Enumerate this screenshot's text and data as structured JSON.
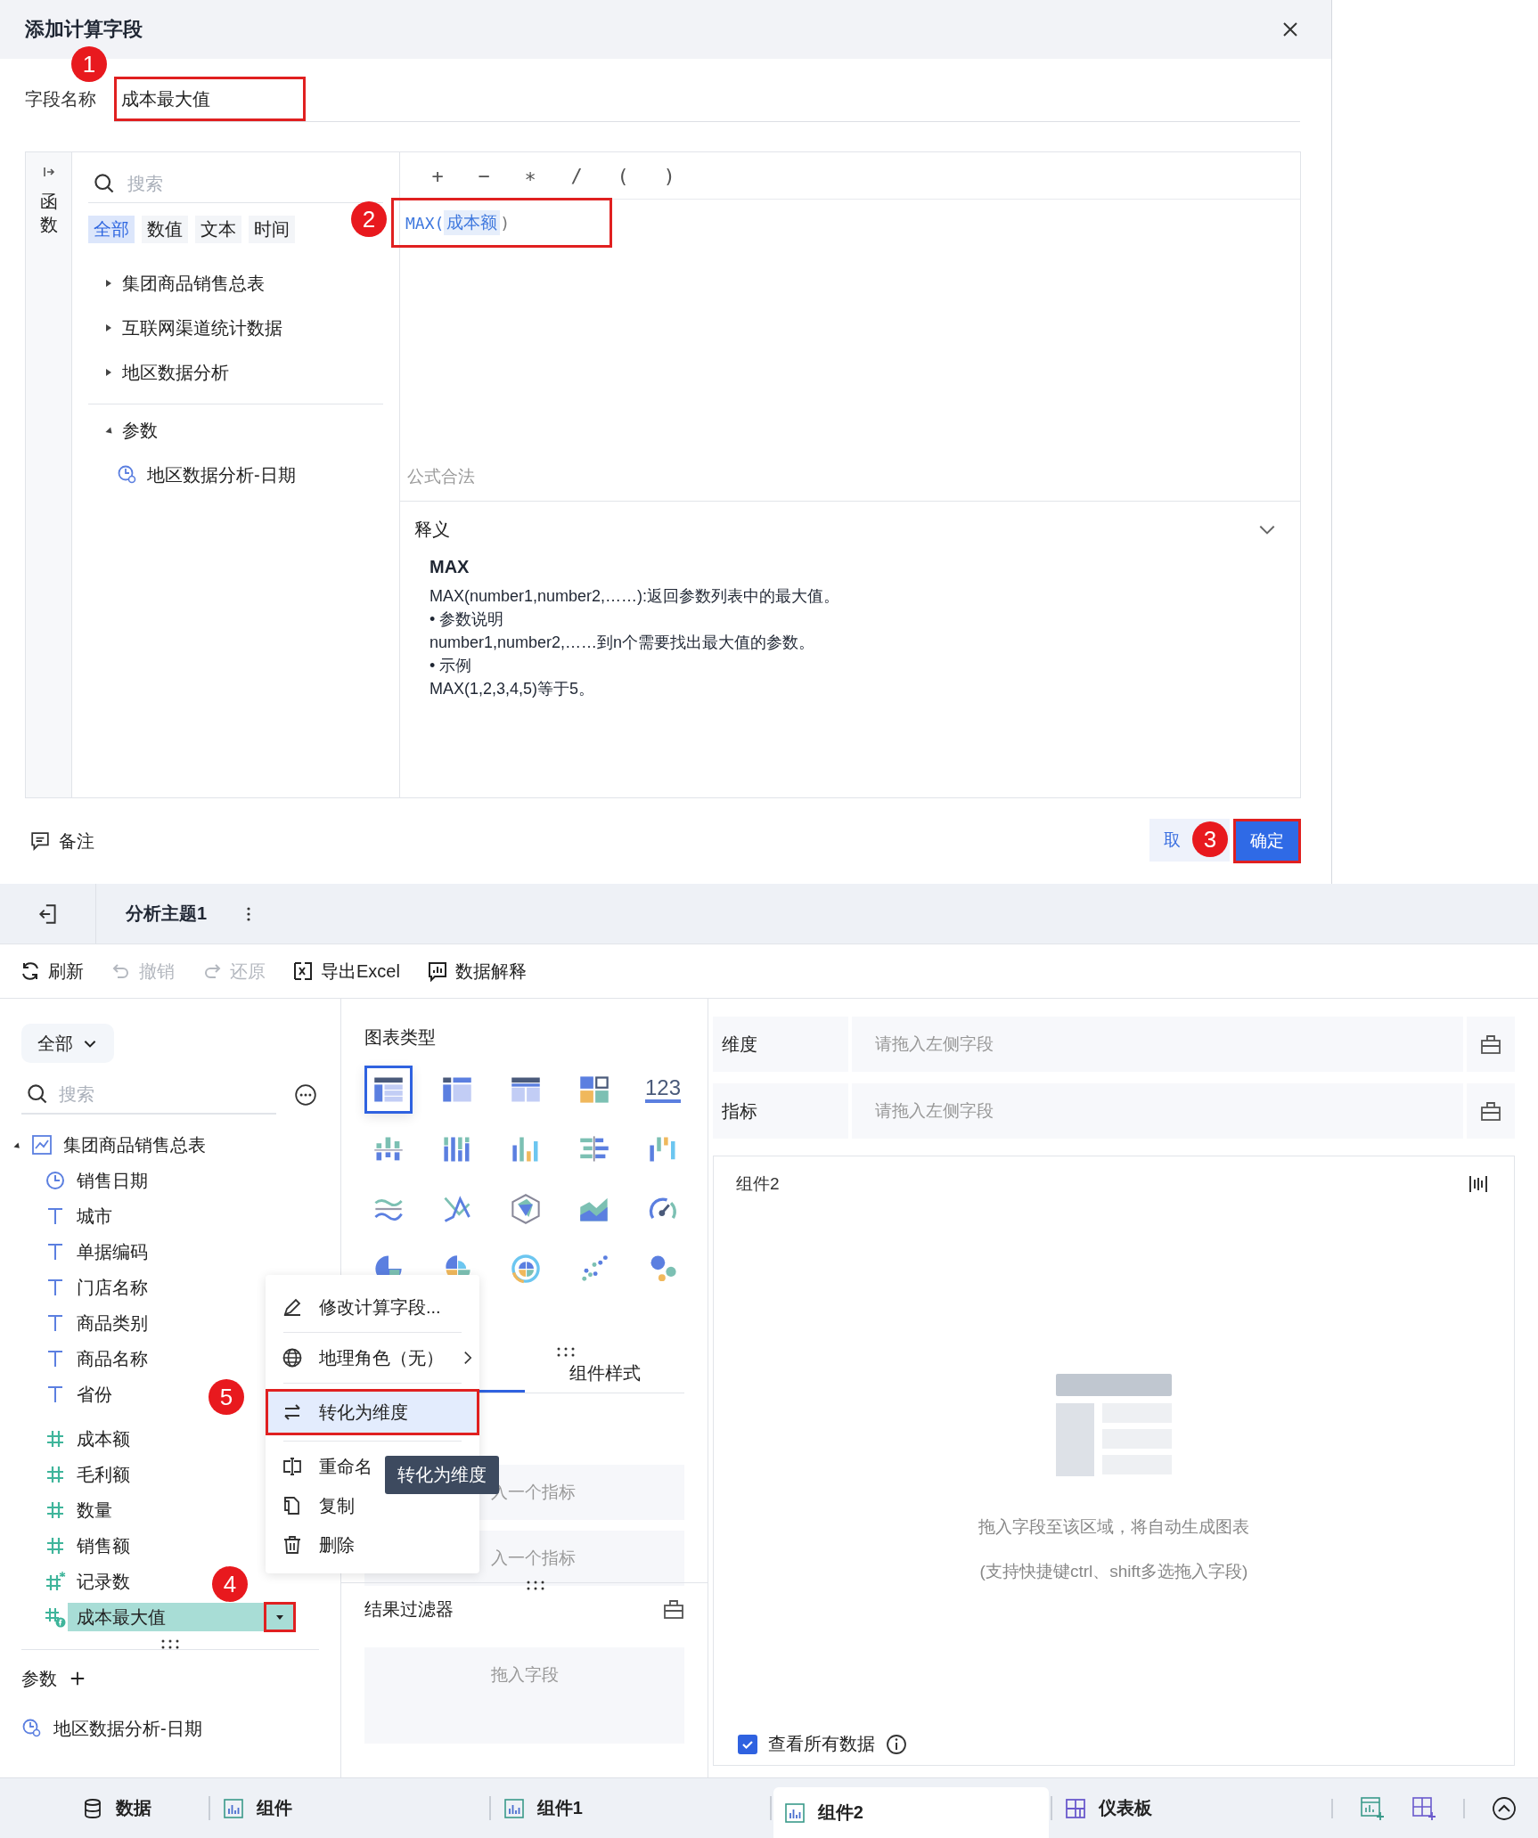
{
  "dialog": {
    "title": "添加计算字段",
    "name_field": {
      "label": "字段名称",
      "value": "成本最大值",
      "marker": "1"
    },
    "side_tab": "函数",
    "search": {
      "placeholder": "搜索"
    },
    "filters": [
      {
        "label": "全部",
        "selected": true
      },
      {
        "label": "数值",
        "selected": false
      },
      {
        "label": "文本",
        "selected": false
      },
      {
        "label": "时间",
        "selected": false
      }
    ],
    "tables": [
      {
        "label": "集团商品销售总表",
        "expanded": false
      },
      {
        "label": "互联网渠道统计数据",
        "expanded": false
      },
      {
        "label": "地区数据分析",
        "expanded": false
      }
    ],
    "params": {
      "label": "参数",
      "expanded": true,
      "children": [
        {
          "label": "地区数据分析-日期"
        }
      ]
    },
    "operators": [
      "+",
      "−",
      "∗",
      "/",
      "(",
      ")"
    ],
    "formula": {
      "func": "MAX(",
      "arg": "成本额",
      "close": ")",
      "marker": "2"
    },
    "status": "公式合法",
    "explain": {
      "title": "释义",
      "name": "MAX",
      "lines": [
        "MAX(number1,number2,……):返回参数列表中的最大值。",
        "• 参数说明",
        "number1,number2,……到n个需要找出最大值的参数。",
        "• 示例",
        "MAX(1,2,3,4,5)等于5。"
      ]
    },
    "note": "备注",
    "cancel": "取",
    "ok": {
      "label": "确定",
      "marker": "3"
    }
  },
  "app": {
    "title": "分析主题1",
    "toolbar": [
      {
        "label": "刷新",
        "disabled": false
      },
      {
        "label": "撤销",
        "disabled": true
      },
      {
        "label": "还原",
        "disabled": true
      },
      {
        "label": "导出Excel",
        "disabled": false
      },
      {
        "label": "数据解释",
        "disabled": false
      }
    ],
    "data_panel": {
      "scope": "全部",
      "search": {
        "placeholder": "搜索"
      },
      "table": {
        "label": "集团商品销售总表",
        "expanded": true,
        "children": [
          {
            "label": "销售日期",
            "kind": "date",
            "selected": false
          },
          {
            "label": "城市",
            "kind": "text",
            "selected": false
          },
          {
            "label": "单据编码",
            "kind": "text",
            "selected": false
          },
          {
            "label": "门店名称",
            "kind": "text",
            "selected": false
          },
          {
            "label": "商品类别",
            "kind": "text",
            "selected": false
          },
          {
            "label": "商品名称",
            "kind": "text",
            "selected": false
          },
          {
            "label": "省份",
            "kind": "text",
            "selected": false
          },
          {
            "label": "成本额",
            "kind": "number",
            "selected": false
          },
          {
            "label": "毛利额",
            "kind": "number",
            "selected": false
          },
          {
            "label": "数量",
            "kind": "number",
            "selected": false
          },
          {
            "label": "销售额",
            "kind": "number",
            "selected": false
          },
          {
            "label": "记录数",
            "kind": "count",
            "selected": false
          },
          {
            "label": "成本最大值",
            "kind": "calc",
            "selected": true,
            "marker": "4"
          }
        ]
      },
      "params_label": "参数",
      "params": [
        {
          "label": "地区数据分析-日期"
        }
      ]
    },
    "context_menu": [
      {
        "label": "修改计算字段...",
        "highlighted": false
      },
      {
        "label": "地理角色（无）",
        "submenu": true,
        "highlighted": false
      },
      {
        "label": "转化为维度",
        "highlighted": true,
        "marker": "5"
      },
      {
        "label": "重命名",
        "highlighted": false
      },
      {
        "label": "复制",
        "highlighted": false
      },
      {
        "label": "删除",
        "highlighted": false
      }
    ],
    "tooltip": "转化为维度",
    "chart_panel": {
      "title": "图表类型",
      "types": [
        {
          "kind": "table",
          "selected": true
        },
        {
          "kind": "crosstab",
          "selected": false
        },
        {
          "kind": "grid",
          "selected": false
        },
        {
          "kind": "cards",
          "selected": false
        },
        {
          "kind": "kpi",
          "label": "123",
          "selected": false
        },
        {
          "kind": "stacked-bar",
          "selected": false
        },
        {
          "kind": "grouped-bar",
          "selected": false
        },
        {
          "kind": "column",
          "selected": false
        },
        {
          "kind": "diverging",
          "selected": false
        },
        {
          "kind": "waterfall",
          "selected": false
        },
        {
          "kind": "multi-line",
          "selected": false
        },
        {
          "kind": "cross-line",
          "selected": false
        },
        {
          "kind": "radar",
          "selected": false
        },
        {
          "kind": "area",
          "selected": false
        },
        {
          "kind": "gauge",
          "selected": false
        },
        {
          "kind": "pie",
          "selected": false
        },
        {
          "kind": "rose",
          "selected": false
        },
        {
          "kind": "sunburst",
          "selected": false
        },
        {
          "kind": "scatter",
          "selected": false
        },
        {
          "kind": "bubble",
          "selected": false
        }
      ],
      "style_tab": "组件样式",
      "metric_slots": [
        "入一个指标",
        "入一个指标"
      ],
      "filter_title": "结果过滤器",
      "filter_placeholder": "拖入字段"
    },
    "shelves": [
      {
        "label": "维度",
        "placeholder": "请拖入左侧字段"
      },
      {
        "label": "指标",
        "placeholder": "请拖入左侧字段"
      }
    ],
    "canvas": {
      "title": "组件2",
      "hint": "拖入字段至该区域，将自动生成图表",
      "hint2": "(支持快捷键ctrl、shift多选拖入字段)",
      "show_all": {
        "label": "查看所有数据",
        "checked": true
      }
    },
    "bottom_tabs": [
      {
        "label": "数据",
        "selected": false
      },
      {
        "label": "组件",
        "selected": false
      },
      {
        "label": "组件1",
        "selected": false
      },
      {
        "label": "组件2",
        "selected": true
      },
      {
        "label": "仪表板",
        "selected": false
      }
    ]
  }
}
